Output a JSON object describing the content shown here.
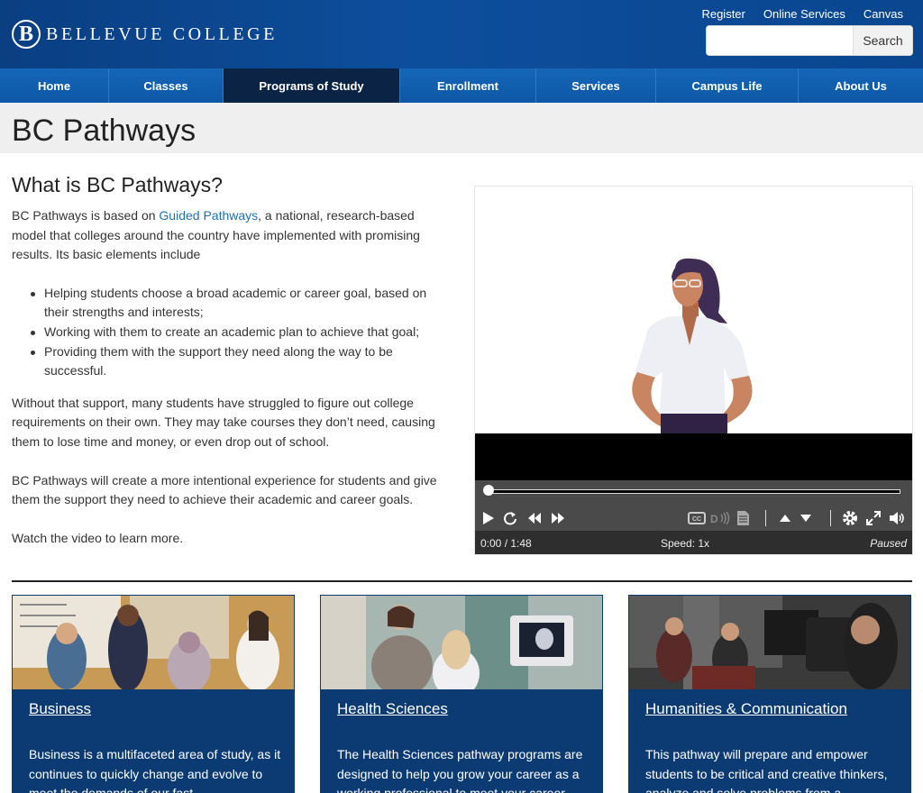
{
  "header": {
    "logo_letter": "B",
    "logo_text": "BELLEVUE COLLEGE",
    "utility_links": [
      "Register",
      "Online Services",
      "Canvas"
    ],
    "search": {
      "placeholder": "",
      "button_label": "Search"
    }
  },
  "nav": {
    "items": [
      {
        "label": "Home"
      },
      {
        "label": "Classes"
      },
      {
        "label": "Programs of Study",
        "active": true
      },
      {
        "label": "Enrollment"
      },
      {
        "label": "Services"
      },
      {
        "label": "Campus Life"
      },
      {
        "label": "About Us"
      }
    ]
  },
  "page": {
    "title": "BC Pathways",
    "section_heading": "What is BC Pathways?",
    "intro_before_link": "BC Pathways is based on ",
    "intro_link": "Guided Pathways",
    "intro_after_link": ", a national, research-based model that colleges around the country have implemented with promising results. Its basic elements include",
    "bullets": [
      "Helping students choose a broad academic or career goal, based on their strengths and interests;",
      "Working with them to create an academic plan to achieve that goal;",
      "Providing them with the support they need along the way to be successful."
    ],
    "para2": "Without that support, many students have struggled to figure out college requirements on their own. They may take courses they don’t need, causing them to lose time and money, or even drop out of school.",
    "para3": "BC Pathways will create a more intentional experience for students and give them the support they need to achieve their academic and career goals.",
    "para4": "Watch the video to learn more."
  },
  "video": {
    "time": "0:00 / 1:48",
    "speed": "Speed: 1x",
    "state": "Paused",
    "progress": 0,
    "controls": [
      "play-icon",
      "replay-icon",
      "rewind-icon",
      "fast-forward-icon",
      "captions-icon",
      "audio-description-icon",
      "transcript-icon",
      "speed-up-icon",
      "speed-down-icon",
      "settings-icon",
      "fullscreen-icon",
      "volume-icon"
    ]
  },
  "cards": [
    {
      "title": "Business",
      "text": "Business is a multifaceted area of study, as it continues to quickly change and evolve to meet the demands of our fast"
    },
    {
      "title": "Health Sciences",
      "text": "The Health Sciences pathway programs are designed to help you grow your career as a working professional to meet your career"
    },
    {
      "title": "Humanities & Communication",
      "text": "This pathway will prepare and empower students to be critical and creative thinkers, analyze and solve problems from a"
    }
  ],
  "colors": {
    "header_blue": "#0d4e9c",
    "nav_blue": "#1566b8",
    "nav_active": "#0b2345",
    "card_blue": "#0c3a72",
    "link_blue": "#1f6fb3"
  }
}
